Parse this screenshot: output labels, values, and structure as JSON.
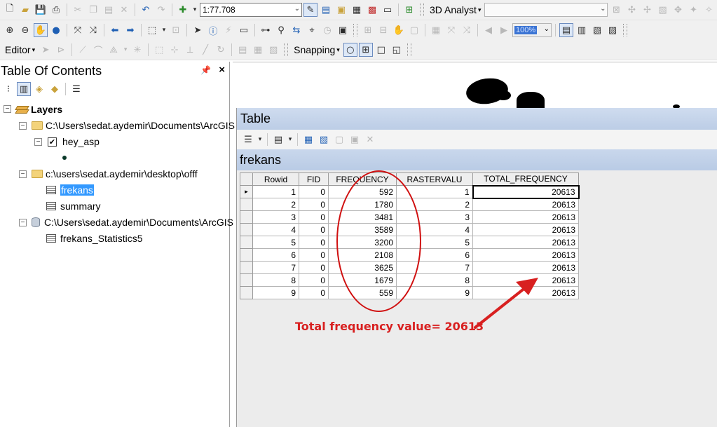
{
  "toolbar1": {
    "scale_value": "1:77.708",
    "analyst_label": "3D Analyst"
  },
  "toolbar2": {
    "zoom_value": "100%"
  },
  "toolbar3": {
    "editor_label": "Editor",
    "snapping_label": "Snapping"
  },
  "toc": {
    "title": "Table Of Contents",
    "root_label": "Layers",
    "items": [
      {
        "label": "C:\\Users\\sedat.aydemir\\Documents\\ArcGIS"
      },
      {
        "label": "hey_asp"
      },
      {
        "label": "c:\\users\\sedat.aydemir\\desktop\\offf"
      },
      {
        "label": "frekans"
      },
      {
        "label": "summary"
      },
      {
        "label": "C:\\Users\\sedat.aydemir\\Documents\\ArcGIS"
      },
      {
        "label": "frekans_Statistics5"
      }
    ]
  },
  "table_window": {
    "title": "Table",
    "layer_tab": "frekans",
    "columns": [
      "Rowid",
      "FID",
      "FREQUENCY",
      "RASTERVALU",
      "TOTAL_FREQUENCY"
    ],
    "rows": [
      [
        "1",
        "0",
        "592",
        "1",
        "20613"
      ],
      [
        "2",
        "0",
        "1780",
        "2",
        "20613"
      ],
      [
        "3",
        "0",
        "3481",
        "3",
        "20613"
      ],
      [
        "4",
        "0",
        "3589",
        "4",
        "20613"
      ],
      [
        "5",
        "0",
        "3200",
        "5",
        "20613"
      ],
      [
        "6",
        "0",
        "2108",
        "6",
        "20613"
      ],
      [
        "7",
        "0",
        "3625",
        "7",
        "20613"
      ],
      [
        "8",
        "0",
        "1679",
        "8",
        "20613"
      ],
      [
        "9",
        "0",
        "559",
        "9",
        "20613"
      ]
    ]
  },
  "annotation": {
    "text": "Total frequency value=  20613",
    "color": "#d82020"
  }
}
